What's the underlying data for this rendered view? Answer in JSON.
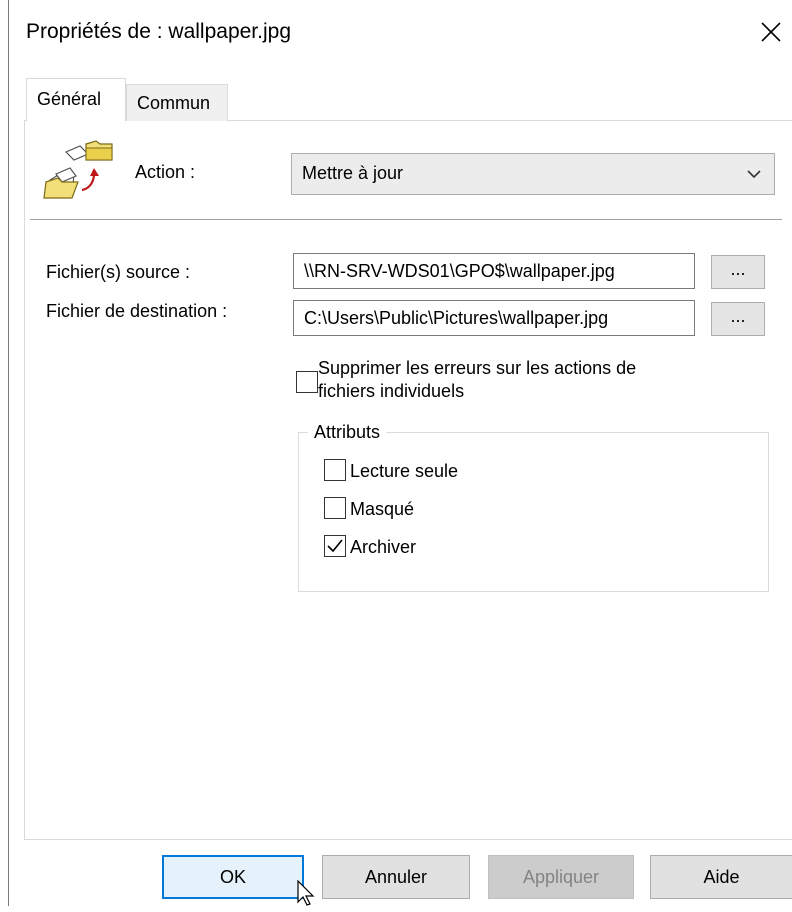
{
  "window": {
    "title": "Propriétés de : wallpaper.jpg"
  },
  "tabs": [
    {
      "label": "Général",
      "active": true
    },
    {
      "label": "Commun",
      "active": false
    }
  ],
  "general": {
    "action_label": "Action :",
    "action_value": "Mettre à jour",
    "source_label": "Fichier(s) source :",
    "source_value": "\\\\RN-SRV-WDS01\\GPO$\\wallpaper.jpg",
    "dest_label": "Fichier de destination :",
    "dest_value": "C:\\Users\\Public\\Pictures\\wallpaper.jpg",
    "browse_label": "...",
    "suppress_errors": {
      "label_line1": "Supprimer les erreurs sur les actions de",
      "label_line2": "fichiers individuels",
      "checked": false
    },
    "attributes": {
      "title": "Attributs",
      "items": [
        {
          "label": "Lecture seule",
          "checked": false
        },
        {
          "label": "Masqué",
          "checked": false
        },
        {
          "label": "Archiver",
          "checked": true
        }
      ]
    }
  },
  "buttons": {
    "ok": "OK",
    "cancel": "Annuler",
    "apply": "Appliquer",
    "help": "Aide"
  },
  "colors": {
    "accent": "#0078d7",
    "disabled_text": "#838383",
    "folder": "#f2df7a"
  }
}
